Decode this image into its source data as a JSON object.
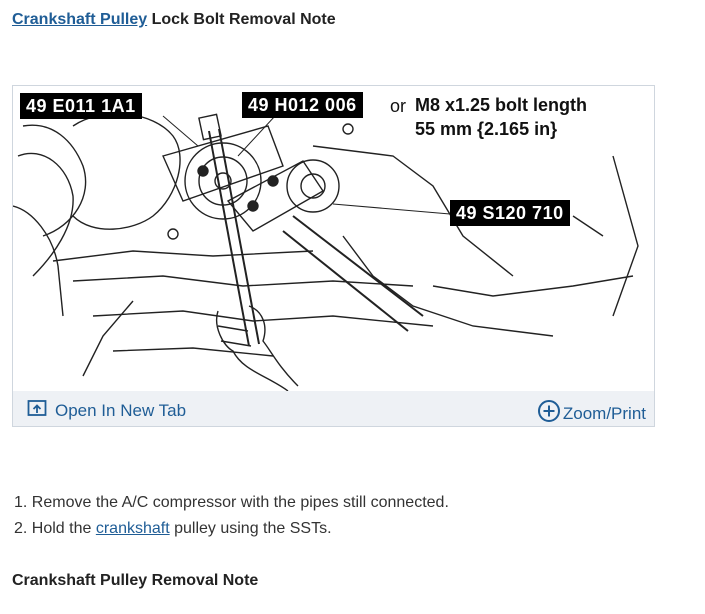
{
  "header": {
    "title_link": "Crankshaft Pulley",
    "title_rest": " Lock Bolt Removal Note"
  },
  "figure": {
    "callouts": [
      "49 E011 1A1",
      "49 H012 006",
      "49 S120 710"
    ],
    "or_word": "or",
    "spec_line1": "M8 x1.25 bolt length",
    "spec_line2": "55 mm {2.165 in}",
    "open_tab_label": "Open In New Tab",
    "zoom_print_label": "Zoom/Print",
    "icons": [
      "open-in-new-tab-icon",
      "zoom-plus-icon"
    ],
    "accent_color": "#1f5d96"
  },
  "steps": [
    {
      "number": "1. ",
      "text": "Remove the A/C compressor with the pipes still connected."
    },
    {
      "number": "2. ",
      "text_before": "Hold the ",
      "link": "crankshaft",
      "text_after": " pulley using the SSTs."
    }
  ],
  "footer": {
    "next_title": "Crankshaft Pulley Removal Note"
  }
}
